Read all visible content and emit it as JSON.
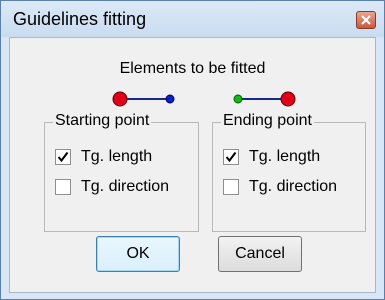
{
  "window": {
    "title": "Guidelines fitting"
  },
  "icons": {
    "close": "close-icon",
    "check": "checkmark-icon"
  },
  "colors": {
    "red_point": "#e0001a",
    "blue_point": "#0a20c8",
    "green_point": "#14b814"
  },
  "elements_label": "Elements to be fitted",
  "starting_point": {
    "title": "Starting point",
    "options": [
      {
        "label": "Tg. length",
        "checked": true
      },
      {
        "label": "Tg. direction",
        "checked": false
      }
    ]
  },
  "ending_point": {
    "title": "Ending point",
    "options": [
      {
        "label": "Tg. length",
        "checked": true
      },
      {
        "label": "Tg. direction",
        "checked": false
      }
    ]
  },
  "buttons": {
    "ok": "OK",
    "cancel": "Cancel"
  }
}
